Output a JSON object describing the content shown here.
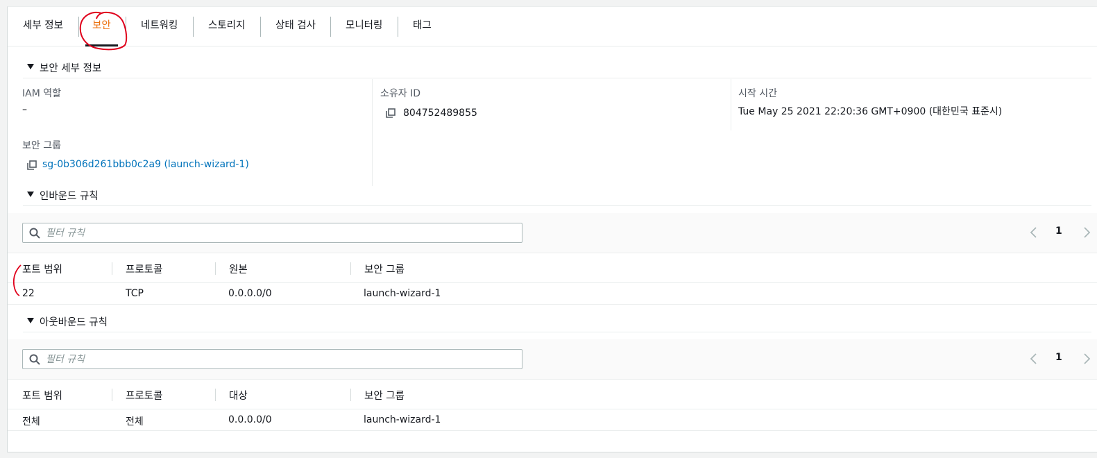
{
  "tabs": [
    {
      "label": "세부 정보"
    },
    {
      "label": "보안"
    },
    {
      "label": "네트워킹"
    },
    {
      "label": "스토리지"
    },
    {
      "label": "상태 검사"
    },
    {
      "label": "모니터링"
    },
    {
      "label": "태그"
    }
  ],
  "active_tab": "보안",
  "security_details": {
    "header": "보안 세부 정보",
    "iam_role_label": "IAM 역할",
    "iam_role_value": "–",
    "owner_id_label": "소유자 ID",
    "owner_id_value": "804752489855",
    "launch_time_label": "시작 시간",
    "launch_time_value": "Tue May 25 2021 22:20:36 GMT+0900 (대한민국 표준시)",
    "security_group_label": "보안 그룹",
    "security_group_value": "sg-0b306d261bbb0c2a9 (launch-wizard-1)"
  },
  "inbound": {
    "header": "인바운드 규칙",
    "filter_placeholder": "필터 규칙",
    "page": "1",
    "columns": [
      "포트 범위",
      "프로토콜",
      "원본",
      "보안 그룹"
    ],
    "rows": [
      [
        "22",
        "TCP",
        "0.0.0.0/0",
        "launch-wizard-1"
      ]
    ]
  },
  "outbound": {
    "header": "아웃바운드 규칙",
    "filter_placeholder": "필터 규칙",
    "page": "1",
    "columns": [
      "포트 범위",
      "프로토콜",
      "대상",
      "보안 그룹"
    ],
    "rows": [
      [
        "전체",
        "전체",
        "0.0.0.0/0",
        "launch-wizard-1"
      ]
    ]
  },
  "colors": {
    "active_tab": "#ec7211",
    "link": "#0073bb",
    "annotation": "#e0001b"
  },
  "icons": {
    "copy": "copy-icon",
    "search": "search-icon",
    "caret": "caret-down-icon",
    "pager_prev": "chevron-left-icon",
    "pager_next": "chevron-right-icon"
  }
}
